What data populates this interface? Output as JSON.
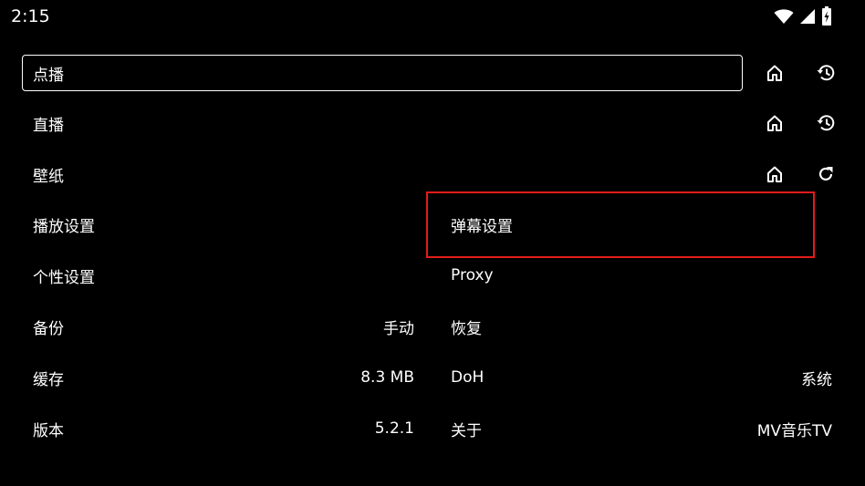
{
  "status_bar": {
    "time": "2:15",
    "icons": [
      "wifi-icon",
      "signal-icon",
      "battery-charging-icon"
    ]
  },
  "settings": {
    "vod": {
      "label": "点播"
    },
    "live": {
      "label": "直播"
    },
    "wallpaper": {
      "label": "壁纸"
    },
    "playback": {
      "label": "播放设置"
    },
    "danmaku": {
      "label": "弹幕设置"
    },
    "personal": {
      "label": "个性设置"
    },
    "proxy": {
      "label": "Proxy"
    },
    "backup": {
      "label": "备份",
      "value": "手动"
    },
    "restore": {
      "label": "恢复"
    },
    "cache": {
      "label": "缓存",
      "value": "8.3 MB"
    },
    "doh": {
      "label": "DoH",
      "value": "系统"
    },
    "version": {
      "label": "版本",
      "value": "5.2.1"
    },
    "about": {
      "label": "关于",
      "value": "MV音乐TV"
    }
  },
  "actions": {
    "vod": [
      "home-icon",
      "history-icon"
    ],
    "live": [
      "home-icon",
      "history-icon"
    ],
    "wallpaper": [
      "home-icon",
      "refresh-icon"
    ]
  },
  "colors": {
    "background": "#000000",
    "text": "#ffffff",
    "highlight": "#e41b1b"
  }
}
